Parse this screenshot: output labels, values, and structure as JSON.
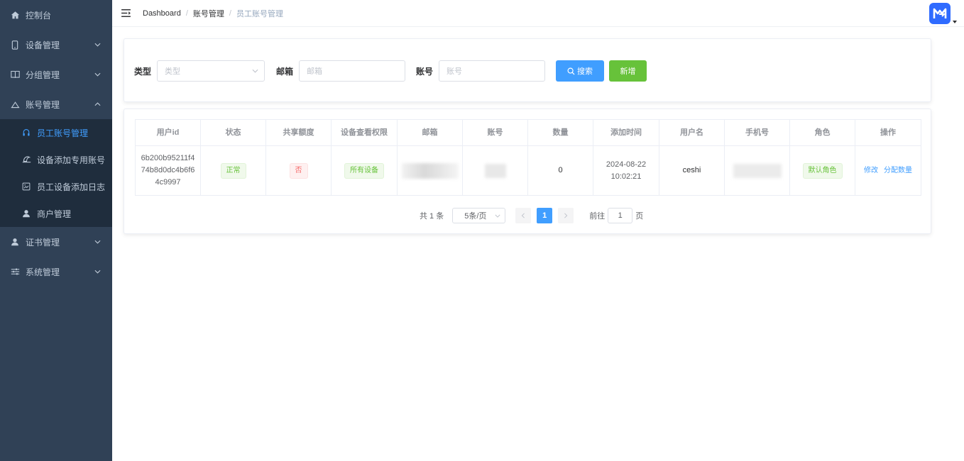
{
  "sidebar": {
    "items": [
      {
        "label": "控制台",
        "icon": "home-icon"
      },
      {
        "label": "设备管理",
        "icon": "phone-icon"
      },
      {
        "label": "分组管理",
        "icon": "book-icon"
      },
      {
        "label": "账号管理",
        "icon": "cloud-icon",
        "expanded": true
      },
      {
        "label": "证书管理",
        "icon": "user-icon"
      },
      {
        "label": "系统管理",
        "icon": "sliders-icon"
      }
    ],
    "subitems": [
      {
        "label": "员工账号管理",
        "icon": "headset-icon",
        "active": true
      },
      {
        "label": "设备添加专用账号",
        "icon": "bell-icon"
      },
      {
        "label": "员工设备添加日志",
        "icon": "picture-icon"
      },
      {
        "label": "商户管理",
        "icon": "person-icon"
      }
    ]
  },
  "header": {
    "breadcrumb": [
      "Dashboard",
      "账号管理",
      "员工账号管理"
    ],
    "separator": "/"
  },
  "filters": {
    "type_label": "类型",
    "type_placeholder": "类型",
    "email_label": "邮箱",
    "email_placeholder": "邮箱",
    "account_label": "账号",
    "account_placeholder": "账号",
    "search_button": "搜索",
    "add_button": "新增"
  },
  "table": {
    "columns": [
      "用户id",
      "状态",
      "共享额度",
      "设备查看权限",
      "邮箱",
      "账号",
      "数量",
      "添加时间",
      "用户名",
      "手机号",
      "角色",
      "操作"
    ],
    "rows": [
      {
        "user_id": "6b200b95211f474b8d0dc4b6f64c9997",
        "status": "正常",
        "shared_quota": "否",
        "device_permission": "所有设备",
        "count": "0",
        "added_time": "2024-08-22 10:02:21",
        "username": "ceshi",
        "role": "默认角色",
        "action_edit": "修改",
        "action_assign": "分配数量"
      }
    ]
  },
  "pagination": {
    "total": "共 1 条",
    "page_size": "5条/页",
    "current_page": "1",
    "goto_label": "前往",
    "goto_value": "1",
    "page_unit": "页"
  },
  "colors": {
    "sidebar_bg": "#304156",
    "submenu_bg": "#1f2d3d",
    "primary": "#409eff",
    "success": "#67c23a",
    "danger": "#f56c6c",
    "avatar": "#2f6bff"
  }
}
